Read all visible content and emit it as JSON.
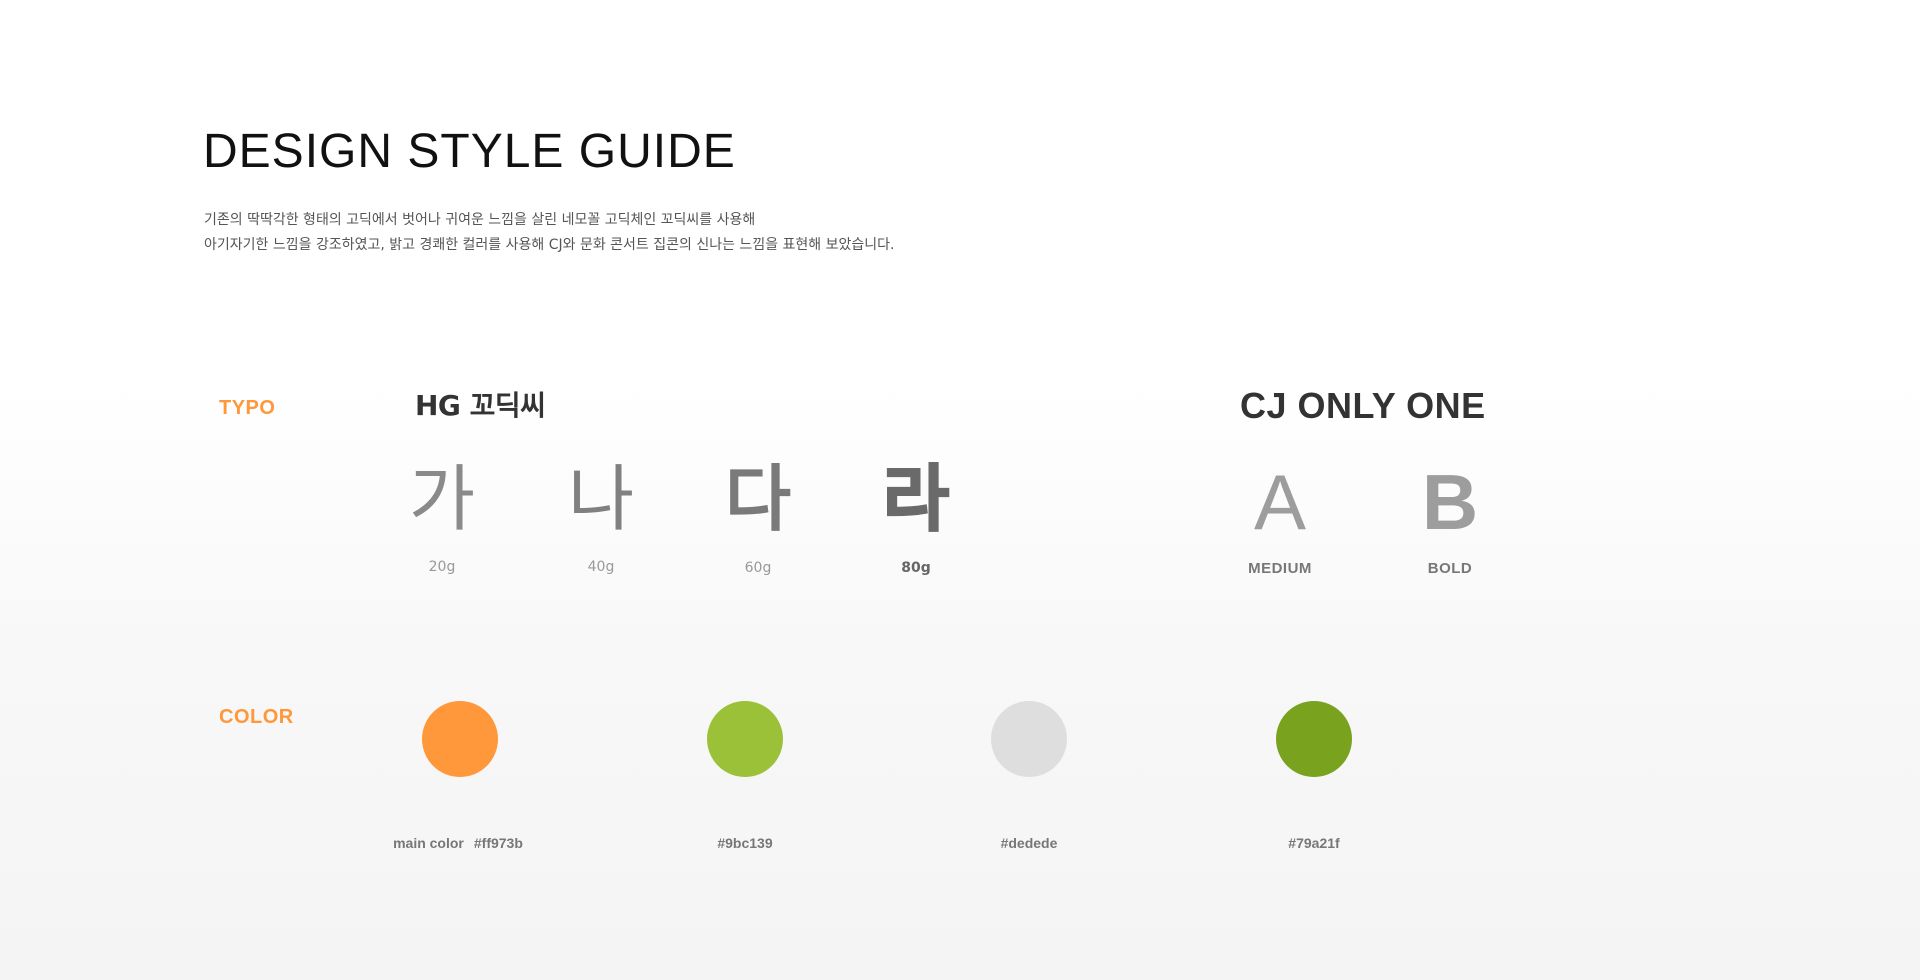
{
  "header": {
    "title": "DESIGN STYLE GUIDE",
    "description_line1": "기존의 딱딱각한 형태의 고딕에서 벗어나 귀여운 느낌을 살린 네모꼴 고딕체인 꼬딕씨를 사용해",
    "description_line2": "아기자기한 느낌을 강조하였고, 밝고 경쾌한 컬러를 사용해 CJ와 문화 콘서트 집콘의 신나는 느낌을 표현해 보았습니다."
  },
  "typo": {
    "label": "TYPO",
    "korean_font": {
      "name": "HG 꼬딕씨",
      "samples": [
        {
          "glyph": "가",
          "weight": "20g"
        },
        {
          "glyph": "나",
          "weight": "40g"
        },
        {
          "glyph": "다",
          "weight": "60g"
        },
        {
          "glyph": "라",
          "weight": "80g"
        }
      ]
    },
    "latin_font": {
      "name": "CJ ONLY ONE",
      "samples": [
        {
          "glyph": "A",
          "weight": "MEDIUM"
        },
        {
          "glyph": "B",
          "weight": "BOLD"
        }
      ]
    }
  },
  "color": {
    "label": "COLOR",
    "swatches": [
      {
        "hex": "#ff973b",
        "prefix": "main color",
        "label": "#ff973b"
      },
      {
        "hex": "#9bc139",
        "label": "#9bc139"
      },
      {
        "hex": "#dedede",
        "label": "#dedede"
      },
      {
        "hex": "#79a21f",
        "label": "#79a21f"
      }
    ]
  }
}
